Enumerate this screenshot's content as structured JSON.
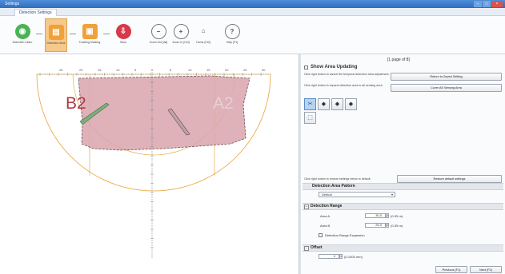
{
  "window": {
    "title": "Settings"
  },
  "ribbon": {
    "tab": "Detection Settings"
  },
  "toolbar": {
    "items": [
      {
        "label": "Detection Video",
        "icon": "video-icon",
        "color": "#4bb356"
      },
      {
        "label": "Detection Area",
        "icon": "area-icon",
        "color": "#f0a13a"
      },
      {
        "label": "Tracking Marking",
        "icon": "tracking-icon",
        "color": "#f0a13a"
      },
      {
        "label": "Save",
        "icon": "save-icon",
        "color": "#d7384a"
      },
      {
        "label": "Zoom Out [Alt]",
        "icon": "zoom-out-icon"
      },
      {
        "label": "Zoom In [Ctrl]",
        "icon": "zoom-in-icon"
      },
      {
        "label": "Home [Ctrl]",
        "icon": "home-icon"
      },
      {
        "label": "Help [F1]",
        "icon": "help-icon"
      }
    ]
  },
  "canvas": {
    "area_labels": [
      "B2",
      "A2"
    ],
    "axis_numbers": [
      "25",
      "20",
      "15",
      "10",
      "5",
      "0",
      "5",
      "10",
      "15",
      "20",
      "25",
      "30"
    ],
    "colors": {
      "area_fill": "#d9a5ad",
      "area_stroke": "#6b5157",
      "arc": "#e8a033",
      "axis": "#7a7a7a"
    }
  },
  "panel": {
    "page_indicator": "[1 page of 8]",
    "show_area_updating": "Show Area Updating",
    "hint_cancel": "Click right button to cancel the temporal detection area adjustment.",
    "hint_expand": "Click right button to expand detection area to all sensing area.",
    "return_button": "Return to Saved Setting",
    "cover_button": "Cover All Sensing Area",
    "hint_restore": "Click right button to restore settings below to default.",
    "restore_button": "Restore default settings",
    "pattern_section": "Detection Area Pattern",
    "pattern_value": "Default",
    "range_section": "Detection Range",
    "area_a_label": "Area A",
    "area_a_value": "30.0",
    "area_a_unit": "(0-35 m)",
    "area_b_label": "Area B",
    "area_b_value": "25.0",
    "area_b_unit": "(0-35 m)",
    "range_expansion": "Detection Range Expansion",
    "offset_section": "Offset",
    "offset_value": "0",
    "offset_unit": "(0-1000 mm)",
    "previous_button": "Previous (F1)",
    "next_button": "Next (F2)"
  }
}
